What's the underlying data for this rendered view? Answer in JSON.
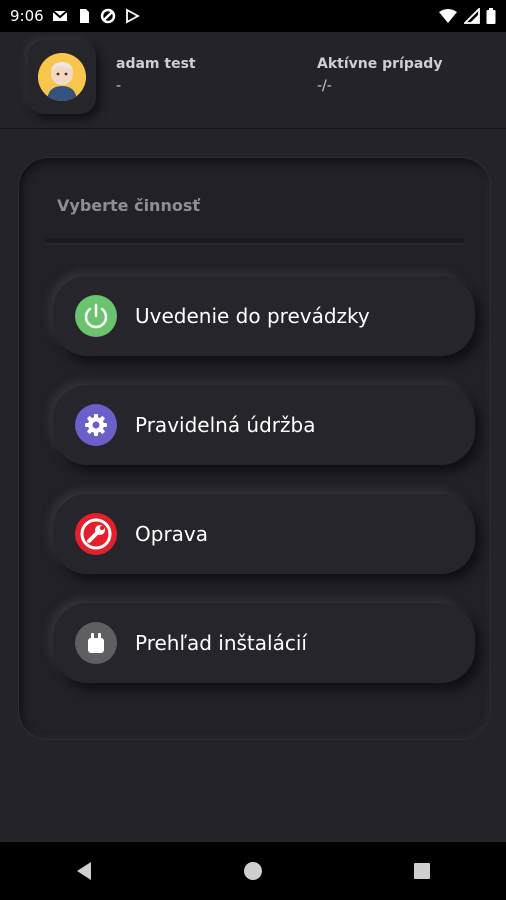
{
  "status_bar": {
    "time": "9:06"
  },
  "header": {
    "user_label": "adam test",
    "user_value": "-",
    "cases_label": "Aktívne prípady",
    "cases_value": "-/-"
  },
  "card": {
    "title": "Vyberte činnosť",
    "items": [
      {
        "label": "Uvedenie do prevádzky",
        "icon": "power-icon",
        "color": "#6cc36e"
      },
      {
        "label": "Pravidelná údržba",
        "icon": "gear-icon",
        "color": "#6b5fc9"
      },
      {
        "label": "Oprava",
        "icon": "wrench-icon",
        "color": "#e5202a"
      },
      {
        "label": "Prehľad inštalácií",
        "icon": "device-icon",
        "color": "#5f5f63"
      }
    ]
  },
  "nav": [
    "back-icon",
    "home-icon",
    "recents-icon"
  ]
}
